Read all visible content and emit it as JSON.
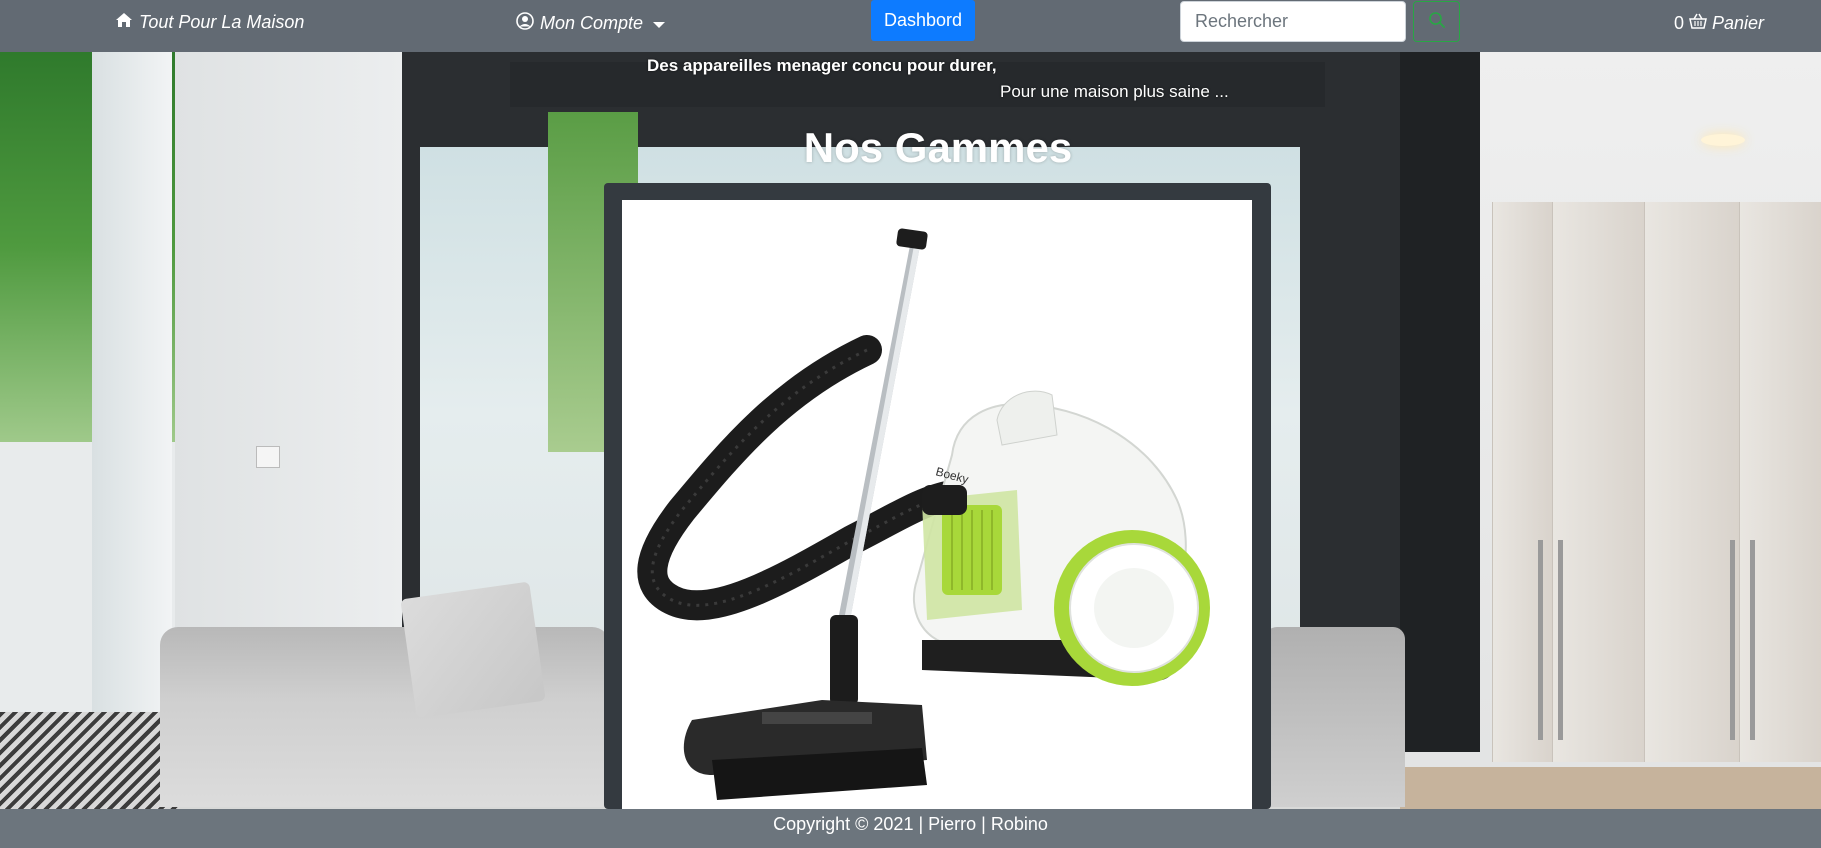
{
  "navbar": {
    "brand_label": "Tout Pour La Maison",
    "brand_icon": "home-icon",
    "account_label": "Mon Compte",
    "account_icon": "user-circle-icon",
    "dashboard_label": "Dashbord",
    "search": {
      "placeholder": "Rechercher",
      "value": ""
    },
    "search_icon": "search-icon",
    "cart": {
      "count": "0",
      "label": "Panier",
      "icon": "basket-icon"
    },
    "colors": {
      "background": "#626a73",
      "dashboard": "#0d7bff",
      "search_outline": "#28a745"
    }
  },
  "hero": {
    "tagline_main": "Des appareilles menager concu pour durer,",
    "tagline_sub": "Pour une maison plus saine ...",
    "section_title": "Nos Gammes"
  },
  "product_card": {
    "image_subject": "vacuum-cleaner",
    "brand_mark": "Boeky",
    "colors": {
      "frame": "#343a40",
      "accent": "#a8d83a"
    }
  },
  "footer": {
    "text": "Copyright © 2021 | Pierro | Robino"
  }
}
